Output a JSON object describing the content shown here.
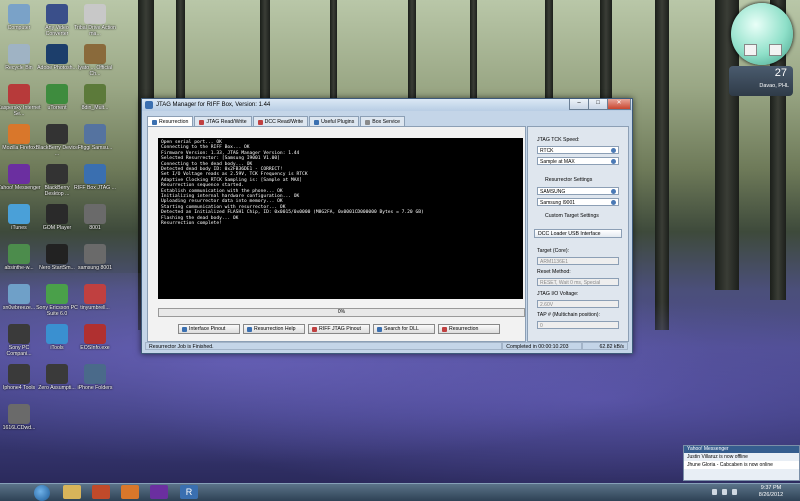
{
  "desktop": {
    "icons": [
      {
        "label": "Computer",
        "icon": "computer-icon",
        "color": "#7aa2c8"
      },
      {
        "label": "Any Video Converter",
        "icon": "video-converter-icon",
        "color": "#3a4f8a"
      },
      {
        "label": "Tribal Drive Action ma...",
        "icon": "shortcut-icon",
        "color": "#c8c8c8"
      },
      {
        "label": "Recycle Bin",
        "icon": "recycle-bin-icon",
        "color": "#9fb3c4"
      },
      {
        "label": "Adobe Photosh...",
        "icon": "photoshop-icon",
        "color": "#1c3e6b"
      },
      {
        "label": "Iyato ... Official Ch...",
        "icon": "shortcut-icon",
        "color": "#8a6a3b"
      },
      {
        "label": "Kaspersky Internet Se...",
        "icon": "kaspersky-icon",
        "color": "#b73a3a"
      },
      {
        "label": "uTorrent",
        "icon": "utorrent-icon",
        "color": "#3e8c3e"
      },
      {
        "label": "8din_Mult...",
        "icon": "shortcut-icon",
        "color": "#5c7a3a"
      },
      {
        "label": "Mozilla Firefox",
        "icon": "firefox-icon",
        "color": "#d9772b"
      },
      {
        "label": "BlackBerry Device ...",
        "icon": "blackberry-icon",
        "color": "#333333"
      },
      {
        "label": "Ffiggi Samsu...",
        "icon": "shortcut-icon",
        "color": "#5573a0"
      },
      {
        "label": "Yahoo! Messenger",
        "icon": "yahoo-messenger-icon",
        "color": "#6b2fa0"
      },
      {
        "label": "BlackBerry Desktop ...",
        "icon": "blackberry-icon",
        "color": "#333333"
      },
      {
        "label": "RIFF Box JTAG ...",
        "icon": "riff-box-icon",
        "color": "#3a6fb0"
      },
      {
        "label": "iTunes",
        "icon": "itunes-icon",
        "color": "#4aa0d8"
      },
      {
        "label": "GOM Player",
        "icon": "gom-player-icon",
        "color": "#2a2a2a"
      },
      {
        "label": "8001",
        "icon": "shortcut-icon",
        "color": "#6a6a6a"
      },
      {
        "label": "absinthe-w...",
        "icon": "absinthe-icon",
        "color": "#4c8c4c"
      },
      {
        "label": "Nero StartSm...",
        "icon": "nero-icon",
        "color": "#222222"
      },
      {
        "label": "samsung 8001",
        "icon": "shortcut-icon",
        "color": "#6a6a6a"
      },
      {
        "label": "sn0wbreeze...",
        "icon": "snowbreeze-icon",
        "color": "#6fa0c8"
      },
      {
        "label": "Sony Ericsson PC Suite 6.0",
        "icon": "sony-ericsson-icon",
        "color": "#4aa04a"
      },
      {
        "label": "tinyumbrell...",
        "icon": "tinyumbrella-icon",
        "color": "#c04040"
      },
      {
        "label": "Sony PC Compani...",
        "icon": "sony-pc-companion-icon",
        "color": "#3a3a3a"
      },
      {
        "label": "iTools",
        "icon": "itools-icon",
        "color": "#3a90d0"
      },
      {
        "label": "EOSInfo.exe",
        "icon": "eosinfo-icon",
        "color": "#b03030"
      },
      {
        "label": "Iphone4 Tools",
        "icon": "iphone-tools-icon",
        "color": "#3a3a3a"
      },
      {
        "label": "Zero Assumpti...",
        "icon": "shortcut-icon",
        "color": "#3a3a3a"
      },
      {
        "label": "iPhone Folders",
        "icon": "folder-icon",
        "color": "#4a6a8a"
      },
      {
        "label": "1616LCDwd...",
        "icon": "shortcut-icon",
        "color": "#6a6a6a"
      }
    ],
    "weather": {
      "temp": "27",
      "city": "Davao, PHL"
    }
  },
  "window": {
    "title": "JTAG Manager for RIFF Box, Version: 1.44",
    "minimize": "–",
    "maximize": "□",
    "close": "✕",
    "tabs": [
      {
        "label": "Resurrection",
        "color": "#3a6fb0",
        "selected": true
      },
      {
        "label": "JTAG Read/Write",
        "color": "#c04040",
        "selected": false
      },
      {
        "label": "DCC Read/Write",
        "color": "#c04040",
        "selected": false
      },
      {
        "label": "Useful Plugins",
        "color": "#3a6fb0",
        "selected": false
      },
      {
        "label": "Box Service",
        "color": "#8a8a8a",
        "selected": false
      }
    ],
    "console_lines": [
      "Open serial port... OK",
      "Connecting to the RIFF Box... OK",
      "Firmware Version: 1.33, JTAG Manager Version: 1.44",
      "Selected Resurrector: [Samsung I9001 V1.00]",
      "",
      "Connecting to the dead body... OK",
      "Detected dead body ID: 0x2FB36DE1 - CORRECT!",
      "Set I/O Voltage reads as 2.59V, TCK Frequency is RTCK",
      "Adaptive Clocking RTCK Sampling is: [Sample at MAX]",
      "",
      "Resurrection sequence started.",
      "Establish communication with the phone... OK",
      "Initializing internal hardware configuration... OK",
      "Uploading resurrector data into memory... OK",
      "Starting communication with resurrector... OK",
      "",
      "Detected an Initialized FLASH1 Chip, ID: 0x0015/0x0000 (M8G2FA, 0x0001CD000000 Bytes = 7.20 GB)",
      "",
      "Flashing the dead body... OK",
      "Resurrection complete!"
    ],
    "progress": {
      "label": "0%",
      "value": 0
    },
    "buttons": [
      {
        "label": "Interface Pinout",
        "color": "#3a6fb0"
      },
      {
        "label": "Resurrection Help",
        "color": "#3a6fb0"
      },
      {
        "label": "RIFF JTAG Pinout",
        "color": "#c04040"
      },
      {
        "label": "Search for DLL",
        "color": "#3a6fb0"
      },
      {
        "label": "Resurrection",
        "color": "#c04040"
      }
    ],
    "side": {
      "tck_label": "JTAG TCK Speed:",
      "tck_value": "RTCK",
      "sample_value": "Sample at MAX",
      "resurrector_label": "Resurrector Settings",
      "vendor_value": "SAMSUNG",
      "model_value": "Samsung I9001",
      "custom_label": "Custom Target Settings",
      "dcc_label": "DCC Loader USB Interface",
      "target_label": "Target (Core):",
      "target_value": "ARM1136E1",
      "reset_label": "Reset Method:",
      "reset_value": "RESET, Wait 0 ms, Special",
      "voltage_label": "JTAG I/O Voltage:",
      "voltage_value": "2.60V",
      "tap_label": "TAP # (Multichain position):",
      "tap_value": "0"
    },
    "status": {
      "message": "Resurrector Job is Finished.",
      "completed": "Completed in 00:00:10.203",
      "speed": "62.82 kB/s"
    }
  },
  "messenger": {
    "title": "Yahoo! Messenger",
    "line1": "Justin Villaruz is now offline",
    "line2": "Jhune Gloria - Cabcaben is now online"
  },
  "taskbar": {
    "time": "9:37 PM",
    "date": "8/26/2012"
  }
}
